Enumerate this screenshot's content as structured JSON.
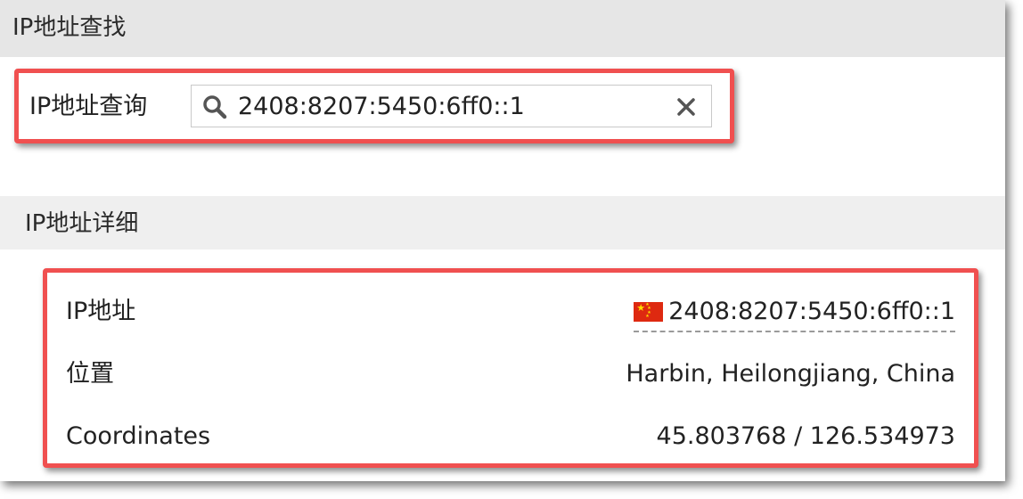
{
  "lookup_section": {
    "title": "IP地址查找",
    "query_label": "IP地址查询",
    "query_value": "2408:8207:5450:6ff0::1",
    "search_icon": "search-icon",
    "clear_icon": "close-icon"
  },
  "details_section": {
    "title": "IP地址详细",
    "rows": [
      {
        "label": "IP地址",
        "value": "2408:8207:5450:6ff0::1",
        "flag": "china-flag-icon"
      },
      {
        "label": "位置",
        "value": "Harbin, Heilongjiang, China"
      },
      {
        "label": "Coordinates",
        "value": "45.803768 / 126.534973"
      }
    ]
  },
  "colors": {
    "highlight_border": "#f05050",
    "header_bg": "#e6e6e6",
    "flag_red": "#de2910",
    "flag_yellow": "#ffde00"
  }
}
